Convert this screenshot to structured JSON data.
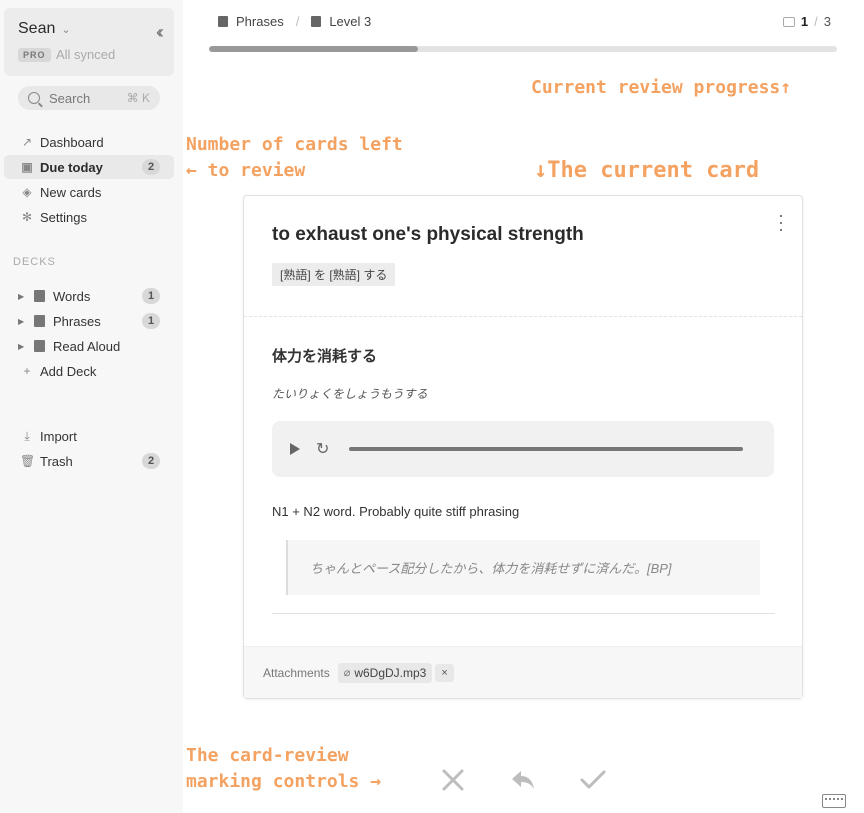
{
  "sidebar": {
    "account": {
      "name": "Sean",
      "plan": "PRO",
      "sync_status": "All synced"
    },
    "search": {
      "label": "Search",
      "shortcut": "⌘ K"
    },
    "nav": [
      {
        "label": "Dashboard",
        "icon": "trend-icon"
      },
      {
        "label": "Due today",
        "icon": "inbox-icon",
        "badge": "2"
      },
      {
        "label": "New cards",
        "icon": "layers-icon"
      },
      {
        "label": "Settings",
        "icon": "gear-icon"
      }
    ],
    "decks_label": "DECKS",
    "decks": [
      {
        "label": "Words",
        "badge": "1"
      },
      {
        "label": "Phrases",
        "badge": "1"
      },
      {
        "label": "Read Aloud"
      }
    ],
    "add_deck": "Add Deck",
    "import": "Import",
    "trash": {
      "label": "Trash",
      "badge": "2"
    }
  },
  "header": {
    "breadcrumb": [
      "Phrases",
      "Level 3"
    ],
    "position": {
      "current": "1",
      "total": "3"
    },
    "progress_fraction": 0.333
  },
  "annotations": {
    "progress": "Current review progress↑",
    "cards_left": "Number of cards left\n← to review",
    "current_card": "↓The current card",
    "controls": "The card-review\nmarking controls →"
  },
  "card": {
    "front": "to exhaust one's physical strength",
    "tag": "[熟語] を [熟語] する",
    "back_title": "体力を消耗する",
    "reading": "たいりょくをしょうもうする",
    "note": "N1 + N2 word. Probably quite stiff phrasing",
    "example": "ちゃんとペース配分したから、体力を消耗せずに済んだ。[BP]",
    "attachments_label": "Attachments",
    "attachment_file": "w6DgDJ.mp3",
    "attachment_remove": "×"
  },
  "controls": [
    "close-icon",
    "undo-icon",
    "check-icon"
  ],
  "colors": {
    "annotation": "#f4a261",
    "sidebar_bg": "#f7f7f7",
    "control_icon": "#bdbdbd"
  }
}
